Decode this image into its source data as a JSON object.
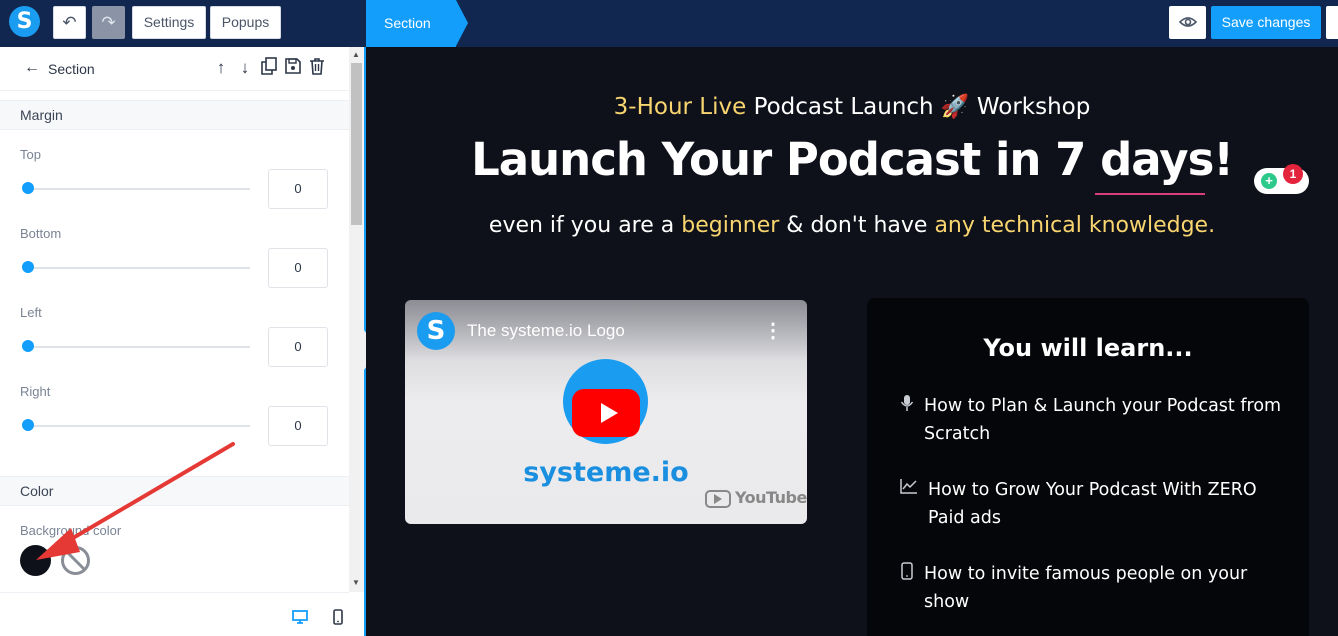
{
  "topbar": {
    "logo": "S",
    "undo_icon": "undo-icon",
    "redo_icon": "redo-icon",
    "settings_label": "Settings",
    "popups_label": "Popups",
    "breadcrumb": "Section",
    "preview_icon": "eye-icon",
    "save_label": "Save changes"
  },
  "panel": {
    "title": "Section",
    "header_icons": [
      "arrow-up-icon",
      "arrow-down-icon",
      "copy-icon",
      "save-icon",
      "trash-icon"
    ],
    "margin_group": "Margin",
    "fields": [
      {
        "label": "Top",
        "value": "0"
      },
      {
        "label": "Bottom",
        "value": "0"
      },
      {
        "label": "Left",
        "value": "0"
      },
      {
        "label": "Right",
        "value": "0"
      }
    ],
    "color_group": "Color",
    "background_label": "Background color",
    "background_value": "#0f111a",
    "devices": [
      "desktop-icon",
      "mobile-icon"
    ]
  },
  "canvas": {
    "pretitle_highlight": "3-Hour Live",
    "pretitle_rest": "Podcast Launch 🚀 Workshop",
    "headline": "Launch Your Podcast in 7 days!",
    "subtitle_parts": [
      "even if you are a ",
      "beginner",
      " & don't have ",
      "any technical knowledge."
    ],
    "notification_count": "1",
    "video": {
      "channel_logo": "S",
      "title": "The systeme.io Logo",
      "brand": "systeme.io",
      "platform": "YouTube"
    },
    "learn": {
      "title": "You will learn...",
      "items": [
        {
          "icon": "microphone-icon",
          "text": "How to Plan & Launch your Podcast from Scratch"
        },
        {
          "icon": "chart-line-icon",
          "text": "How to Grow Your Podcast With ZERO Paid ads"
        },
        {
          "icon": "mobile-icon",
          "text": "How to invite famous people on your show"
        }
      ]
    }
  },
  "colors": {
    "accent": "#149efc",
    "topbar": "#122750",
    "canvas_bg": "#0f111a",
    "highlight": "#f8d56f",
    "annotation_arrow": "#e53935"
  }
}
